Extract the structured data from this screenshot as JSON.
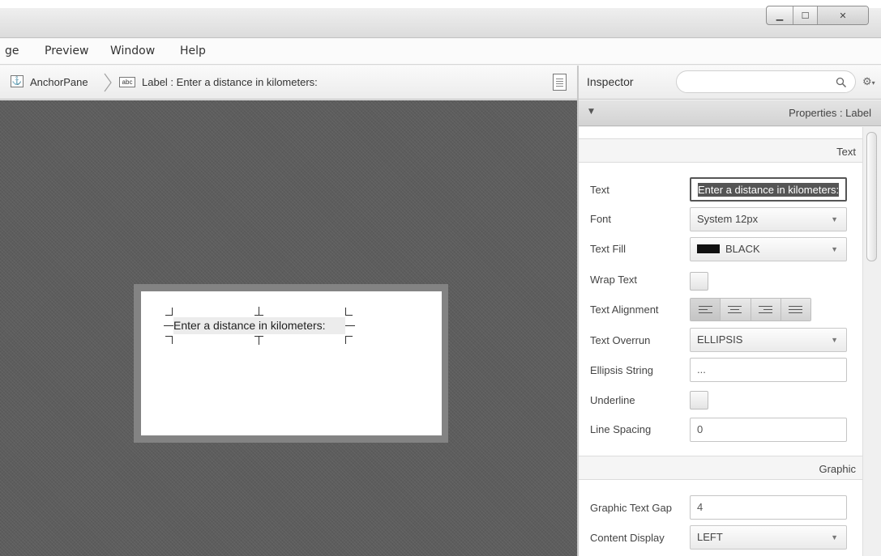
{
  "window": {
    "buttons": {
      "minimize": "▁",
      "maximize": "☐",
      "close": "✕"
    }
  },
  "menubar": {
    "items": [
      "ge",
      "Preview",
      "Window",
      "Help"
    ]
  },
  "breadcrumb": {
    "root": "AnchorPane",
    "abc_badge": "abc",
    "current": "Label : Enter a distance in kilometers:"
  },
  "canvas": {
    "label_text": "Enter a distance in kilometers:"
  },
  "inspector": {
    "title": "Inspector",
    "search": {
      "value": "",
      "placeholder": ""
    },
    "search_icon": "search-icon",
    "gear_icon": "gear-icon",
    "properties_header": "Properties : Label",
    "sections": {
      "text": "Text",
      "graphic": "Graphic"
    },
    "rows": {
      "text": {
        "label": "Text",
        "value": "Enter a distance in kilometers:"
      },
      "font": {
        "label": "Font",
        "value": "System 12px"
      },
      "text_fill": {
        "label": "Text Fill",
        "value": "BLACK",
        "swatch_color": "#111111"
      },
      "wrap_text": {
        "label": "Wrap Text",
        "checked": false
      },
      "text_alignment": {
        "label": "Text Alignment",
        "selected": "LEFT"
      },
      "text_overrun": {
        "label": "Text Overrun",
        "value": "ELLIPSIS"
      },
      "ellipsis_string": {
        "label": "Ellipsis String",
        "value": "..."
      },
      "underline": {
        "label": "Underline",
        "checked": false
      },
      "line_spacing": {
        "label": "Line Spacing",
        "value": "0"
      },
      "graphic_text_gap": {
        "label": "Graphic Text Gap",
        "value": "4"
      },
      "content_display": {
        "label": "Content Display",
        "value": "LEFT"
      }
    }
  }
}
